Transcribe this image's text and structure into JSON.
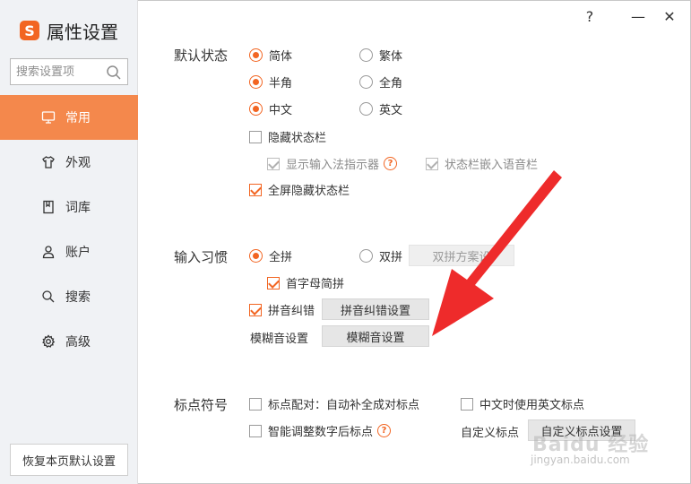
{
  "app": {
    "logo_letter": "S",
    "title": "属性设置",
    "accent_color": "#f26522"
  },
  "titlebar": {
    "help": "?",
    "minimize": "—",
    "close": "✕"
  },
  "sidebar": {
    "search_placeholder": "搜索设置项",
    "items": [
      {
        "label": "常用",
        "icon": "monitor-icon",
        "active": true
      },
      {
        "label": "外观",
        "icon": "shirt-icon",
        "active": false
      },
      {
        "label": "词库",
        "icon": "book-icon",
        "active": false
      },
      {
        "label": "账户",
        "icon": "user-icon",
        "active": false
      },
      {
        "label": "搜索",
        "icon": "search-icon",
        "active": false
      },
      {
        "label": "高级",
        "icon": "gear-icon",
        "active": false
      }
    ],
    "restore_label": "恢复本页默认设置"
  },
  "default_state": {
    "label": "默认状态",
    "simplified": "简体",
    "traditional": "繁体",
    "half_width": "半角",
    "full_width": "全角",
    "chinese": "中文",
    "english": "英文",
    "hide_status_bar": "隐藏状态栏",
    "show_ime_indicator": "显示输入法指示器",
    "status_bar_embed_voice": "状态栏嵌入语音栏",
    "fullscreen_hide_status_bar": "全屏隐藏状态栏"
  },
  "input_habit": {
    "label": "输入习惯",
    "full_pinyin": "全拼",
    "double_pinyin": "双拼",
    "double_pinyin_settings": "双拼方案设",
    "initial_abbrev": "首字母简拼",
    "pinyin_correction": "拼音纠错",
    "pinyin_correction_settings": "拼音纠错设置",
    "fuzzy_label": "模糊音设置",
    "fuzzy_button": "模糊音设置"
  },
  "punctuation": {
    "label": "标点符号",
    "auto_pair": "标点配对：自动补全成对标点",
    "english_punct_in_chinese": "中文时使用英文标点",
    "smart_number_punct": "智能调整数字后标点",
    "custom_label": "自定义标点",
    "custom_button": "自定义标点设置"
  },
  "watermark": {
    "brand": "Baidu 经验",
    "url": "jingyan.baidu.com"
  }
}
